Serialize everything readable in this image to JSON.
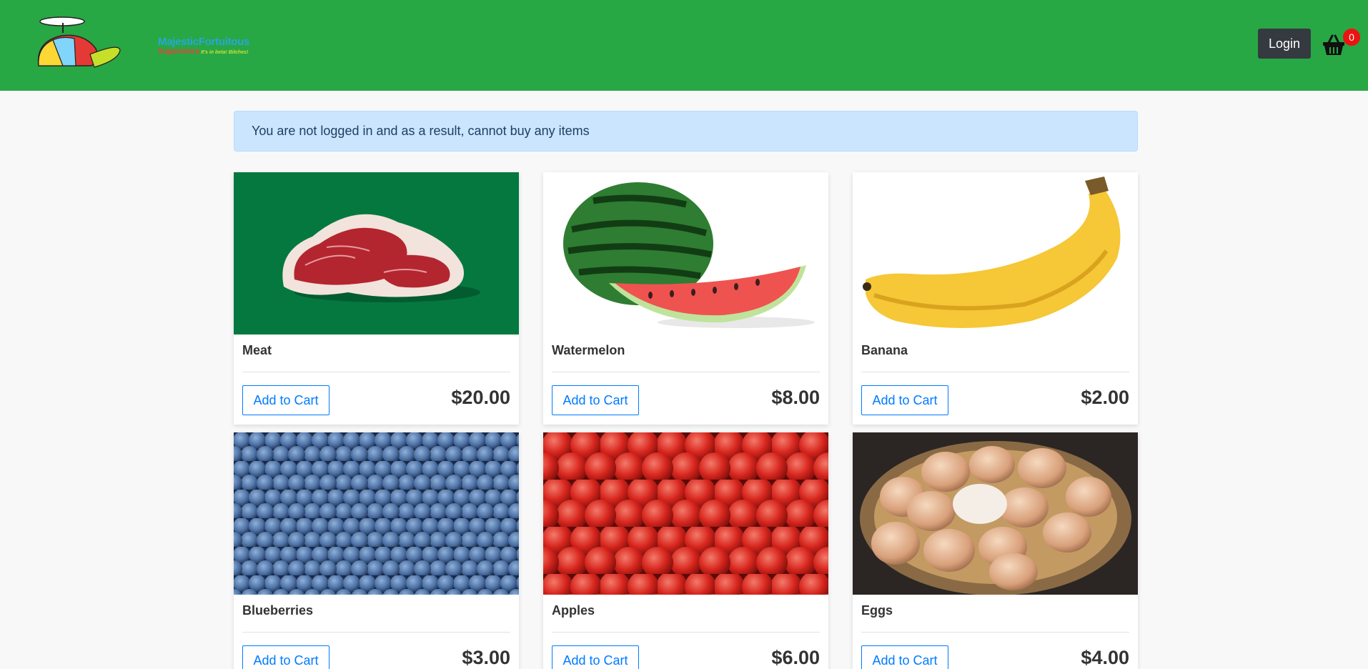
{
  "header": {
    "logo": {
      "name": "MajesticFortuitous",
      "sub": "Superstore",
      "tagline": "It's in beta! Bitches!"
    },
    "login_label": "Login",
    "cart_count": "0",
    "colors": {
      "navbar": "#28a745",
      "login_bg": "#343a40",
      "badge": "#ee1111"
    }
  },
  "alert": {
    "text": "You are not logged in and as a result, cannot buy any items"
  },
  "products": [
    {
      "name": "Meat",
      "price": "$20.00",
      "button": "Add to Cart",
      "image": "t-bone-steak-on-green"
    },
    {
      "name": "Watermelon",
      "price": "$8.00",
      "button": "Add to Cart",
      "image": "watermelon-with-slice"
    },
    {
      "name": "Banana",
      "price": "$2.00",
      "button": "Add to Cart",
      "image": "single-banana"
    },
    {
      "name": "Blueberries",
      "price": "$3.00",
      "button": "Add to Cart",
      "image": "blueberries-pile"
    },
    {
      "name": "Apples",
      "price": "$6.00",
      "button": "Add to Cart",
      "image": "red-apples-pile"
    },
    {
      "name": "Eggs",
      "price": "$4.00",
      "button": "Add to Cart",
      "image": "eggs-in-basket"
    }
  ]
}
